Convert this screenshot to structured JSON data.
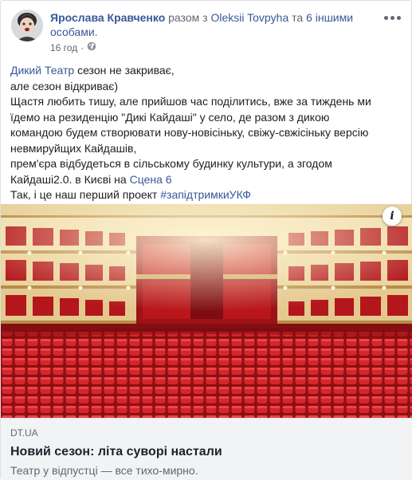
{
  "post": {
    "author": "Ярослава Кравченко",
    "with_text": "разом з",
    "tagged_person": "Oleksii Tovpyha",
    "and_text": "та",
    "others": "6 іншими особами.",
    "time": "16 год",
    "privacy_icon": "globe-icon"
  },
  "body": {
    "line1_link": "Дикий Театр",
    "line1_rest": " сезон не закриває,",
    "line2": "але сезон відкриває)",
    "line3": "Щастя любить тишу, але прийшов час поділитись, вже за тиждень ми",
    "line4": "їдемо на резиденцію \"Дикі Кайдаші\" у село, де разом з дикою",
    "line5": "командою будем створювати нову-новісіньку, свіжу-свжісіньку версію",
    "line6": "невмируйщих Кайдашів,",
    "line7": "прем'єра відбудеться в сільському будинку культури, а згодом",
    "line8_text": "Кайдаші2.0. в Києві на ",
    "line8_link": "Сцена 6",
    "line9_text": "Так, і це наш перший проект ",
    "line9_link": "#запідтримкиУКФ"
  },
  "link_preview": {
    "domain": "DT.UA",
    "title": "Новий сезон: літа суворі настали",
    "description": "Театр у відпустці — все тихо-мирно.",
    "info_icon": "info-icon"
  },
  "colors": {
    "link": "#385898",
    "footer_bg": "#f2f3f5",
    "seat_red": "#c0171b",
    "gold": "#d8b56a"
  }
}
